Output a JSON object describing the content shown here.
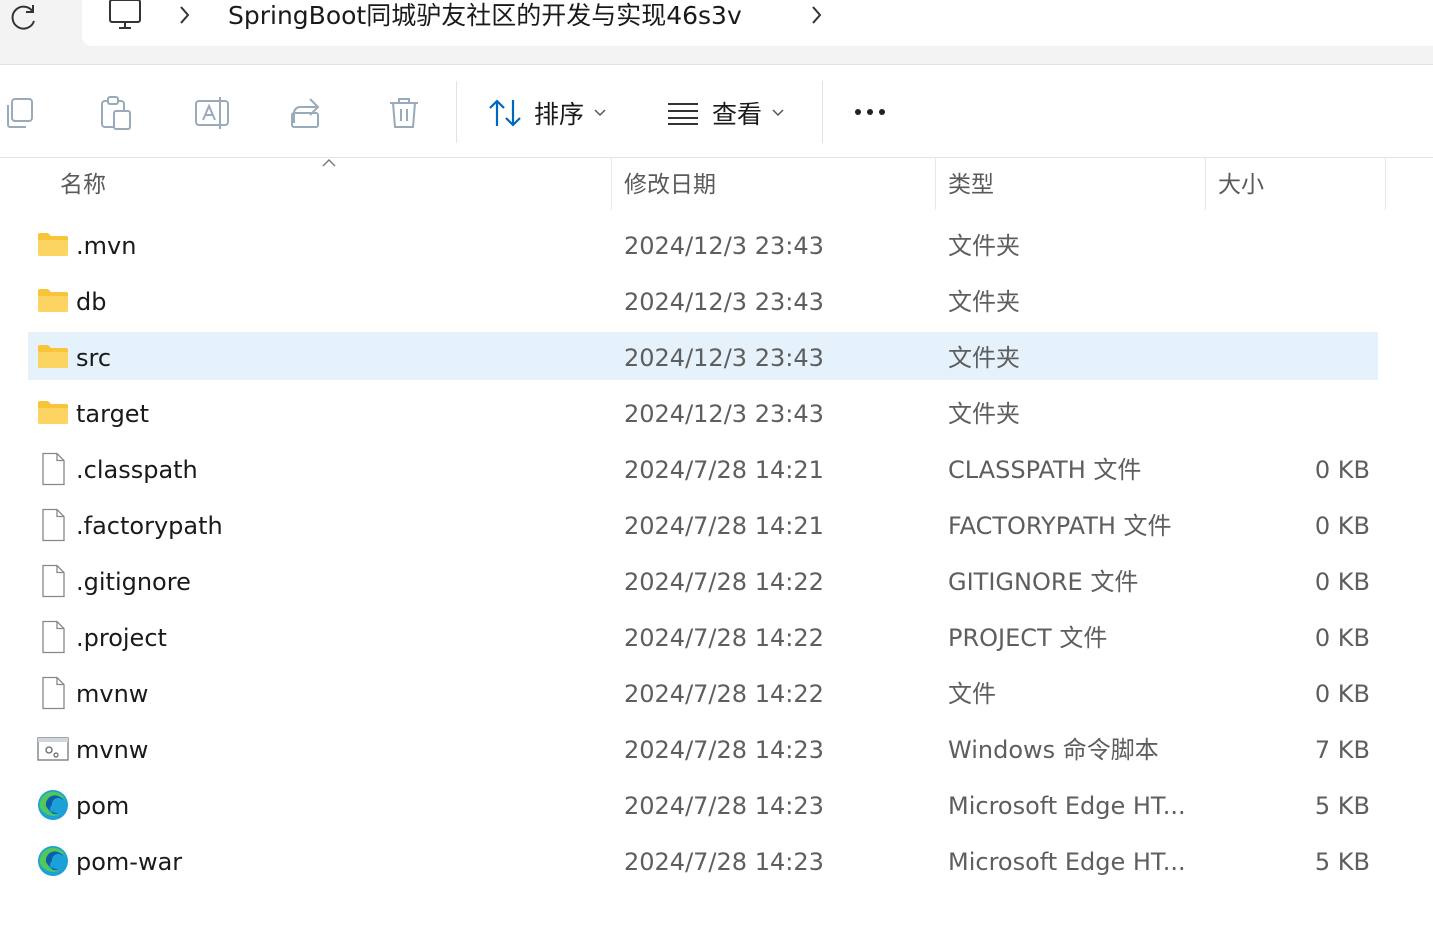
{
  "address": {
    "path_folder": "SpringBoot同城驴友社区的开发与实现46s3v"
  },
  "toolbar": {
    "sort_label": "排序",
    "view_label": "查看"
  },
  "columns": {
    "name": "名称",
    "date": "修改日期",
    "type": "类型",
    "size": "大小"
  },
  "files": [
    {
      "name": ".mvn",
      "date": "2024/12/3 23:43",
      "type": "文件夹",
      "size": "",
      "icon": "folder-icon",
      "selected": false
    },
    {
      "name": "db",
      "date": "2024/12/3 23:43",
      "type": "文件夹",
      "size": "",
      "icon": "folder-icon",
      "selected": false
    },
    {
      "name": "src",
      "date": "2024/12/3 23:43",
      "type": "文件夹",
      "size": "",
      "icon": "folder-icon",
      "selected": true
    },
    {
      "name": "target",
      "date": "2024/12/3 23:43",
      "type": "文件夹",
      "size": "",
      "icon": "folder-icon",
      "selected": false
    },
    {
      "name": ".classpath",
      "date": "2024/7/28 14:21",
      "type": "CLASSPATH 文件",
      "size": "0 KB",
      "icon": "file-icon",
      "selected": false
    },
    {
      "name": ".factorypath",
      "date": "2024/7/28 14:21",
      "type": "FACTORYPATH 文件",
      "size": "0 KB",
      "icon": "file-icon",
      "selected": false
    },
    {
      "name": ".gitignore",
      "date": "2024/7/28 14:22",
      "type": "GITIGNORE 文件",
      "size": "0 KB",
      "icon": "file-icon",
      "selected": false
    },
    {
      "name": ".project",
      "date": "2024/7/28 14:22",
      "type": "PROJECT 文件",
      "size": "0 KB",
      "icon": "file-icon",
      "selected": false
    },
    {
      "name": "mvnw",
      "date": "2024/7/28 14:22",
      "type": "文件",
      "size": "0 KB",
      "icon": "file-icon",
      "selected": false
    },
    {
      "name": "mvnw",
      "date": "2024/7/28 14:23",
      "type": "Windows 命令脚本",
      "size": "7 KB",
      "icon": "script-icon",
      "selected": false
    },
    {
      "name": "pom",
      "date": "2024/7/28 14:23",
      "type": "Microsoft Edge HT...",
      "size": "5 KB",
      "icon": "edge-icon",
      "selected": false
    },
    {
      "name": "pom-war",
      "date": "2024/7/28 14:23",
      "type": "Microsoft Edge HT...",
      "size": "5 KB",
      "icon": "edge-icon",
      "selected": false
    }
  ],
  "colors": {
    "selection": "#e5f1fb",
    "folder": "#f8c43a",
    "accent": "#0067c0"
  }
}
